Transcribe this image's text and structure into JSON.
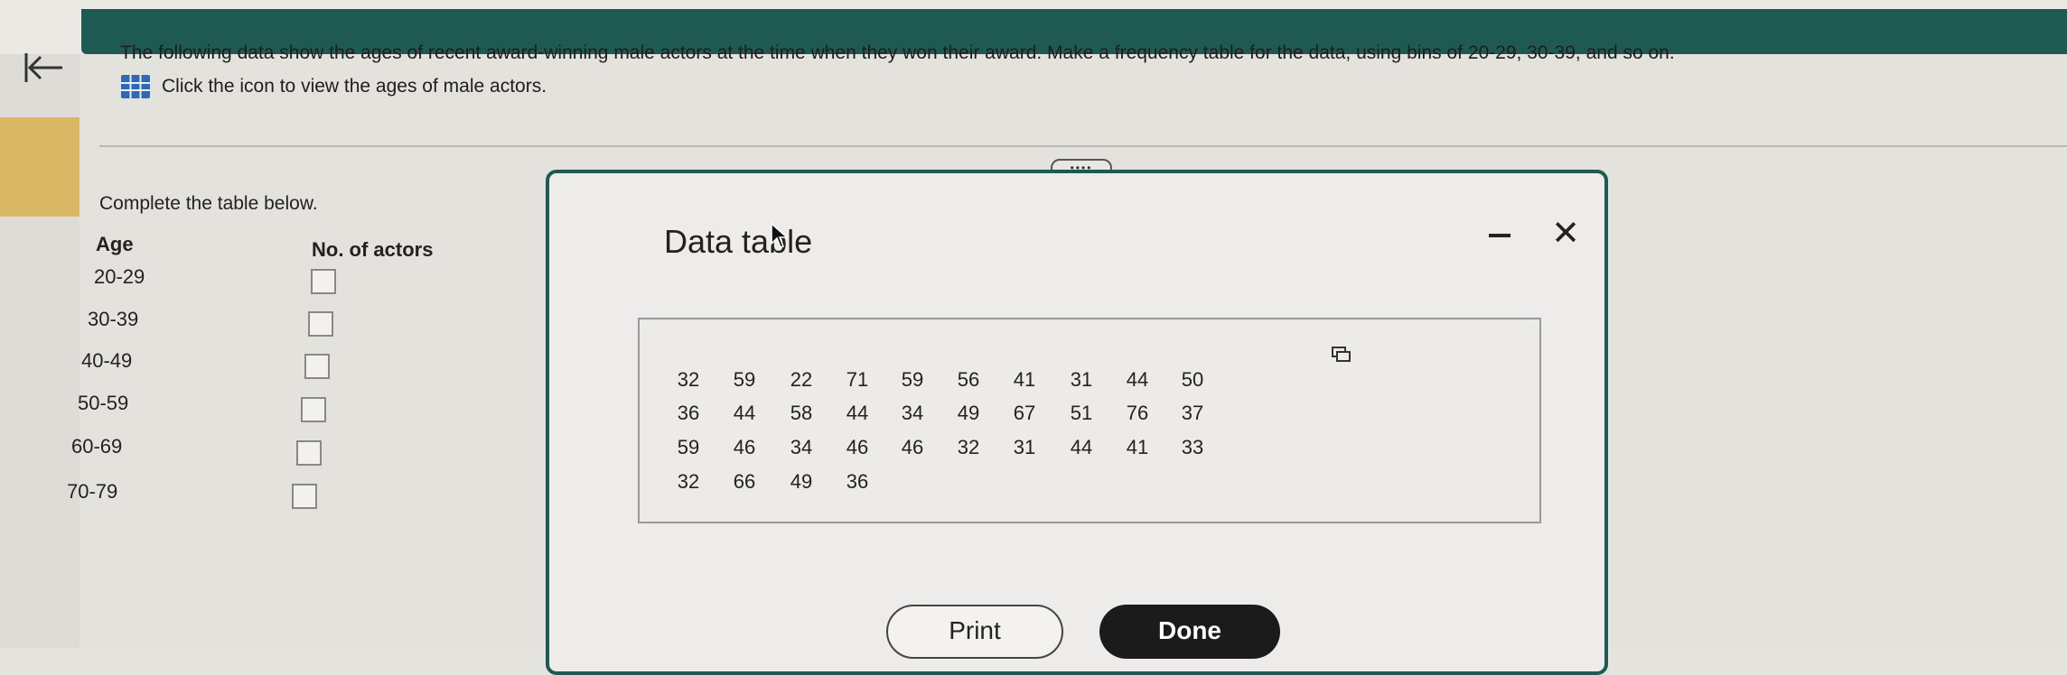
{
  "question": {
    "text": "The following data show the ages of recent award-winning male actors at the time when they won their award. Make a frequency table for the data, using bins of 20-29, 30-39, and so on.",
    "prompt": "Click the icon to view the ages of male actors."
  },
  "form": {
    "instruction": "Complete the table below.",
    "col_age": "Age",
    "col_count": "No. of actors",
    "rows": [
      {
        "age": "20-29",
        "value": ""
      },
      {
        "age": "30-39",
        "value": ""
      },
      {
        "age": "40-49",
        "value": ""
      },
      {
        "age": "50-59",
        "value": ""
      },
      {
        "age": "60-69",
        "value": ""
      },
      {
        "age": "70-79",
        "value": ""
      }
    ]
  },
  "dialog": {
    "title": "Data table",
    "columns": [
      [
        "32",
        "36",
        "59",
        "32"
      ],
      [
        "59",
        "44",
        "46",
        "66"
      ],
      [
        "22",
        "58",
        "34",
        "49"
      ],
      [
        "71",
        "44",
        "46",
        "36"
      ],
      [
        "59",
        "34",
        "46"
      ],
      [
        "56",
        "49",
        "32"
      ],
      [
        "41",
        "67",
        "31"
      ],
      [
        "31",
        "51",
        "44"
      ],
      [
        "44",
        "76",
        "41"
      ],
      [
        "50",
        "37",
        "33"
      ]
    ],
    "print_label": "Print",
    "done_label": "Done",
    "drag_handle": "••••",
    "close_glyph": "✕"
  },
  "colors": {
    "header": "#1f5a52",
    "accent": "#d9b865",
    "done_bg": "#1b1b1b"
  },
  "icons": [
    "back-arrow-icon",
    "table-grid-icon",
    "minimize-icon",
    "close-icon",
    "copy-icon",
    "mouse-cursor-icon"
  ]
}
